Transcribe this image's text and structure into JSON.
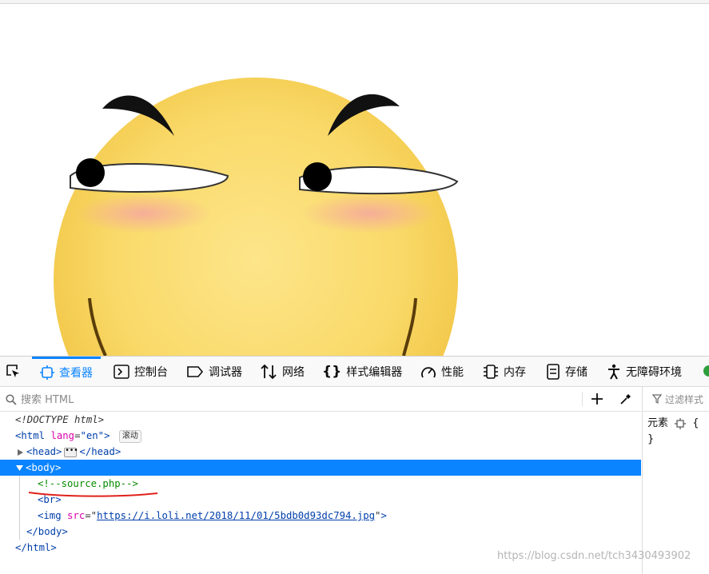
{
  "devtools": {
    "tabs": [
      {
        "label": "查看器",
        "icon": "inspector-icon",
        "active": true
      },
      {
        "label": "控制台",
        "icon": "console-icon"
      },
      {
        "label": "调试器",
        "icon": "debugger-icon"
      },
      {
        "label": "网络",
        "icon": "network-icon"
      },
      {
        "label": "样式编辑器",
        "icon": "style-editor-icon"
      },
      {
        "label": "性能",
        "icon": "performance-icon"
      },
      {
        "label": "内存",
        "icon": "memory-icon"
      },
      {
        "label": "存储",
        "icon": "storage-icon"
      },
      {
        "label": "无障碍环境",
        "icon": "accessibility-icon"
      }
    ],
    "search": {
      "placeholder": "搜索 HTML"
    },
    "rules": {
      "filter_placeholder": "过滤样式",
      "element_label": "元素",
      "open_brace": "{",
      "close_brace": "}"
    },
    "accent_color": "#0a84ff"
  },
  "markup": {
    "doctype": "<!DOCTYPE html>",
    "html_open": "<html",
    "html_attr_name": "lang",
    "html_attr_value": "\"en\"",
    "html_close_bracket": ">",
    "scroll_badge": "滚动",
    "head_open": "<head>",
    "head_close": "</head>",
    "body_open": "<body>",
    "comment": "<!--source.php-->",
    "br": "<br>",
    "img_open": "<img",
    "img_attr_name": "src",
    "img_src": "https://i.loli.net/2018/11/01/5bdb0d93dc794.jpg",
    "img_close": ">",
    "body_close": "</body>",
    "html_close": "</html>"
  },
  "watermark": "https://blog.csdn.net/tch3430493902"
}
